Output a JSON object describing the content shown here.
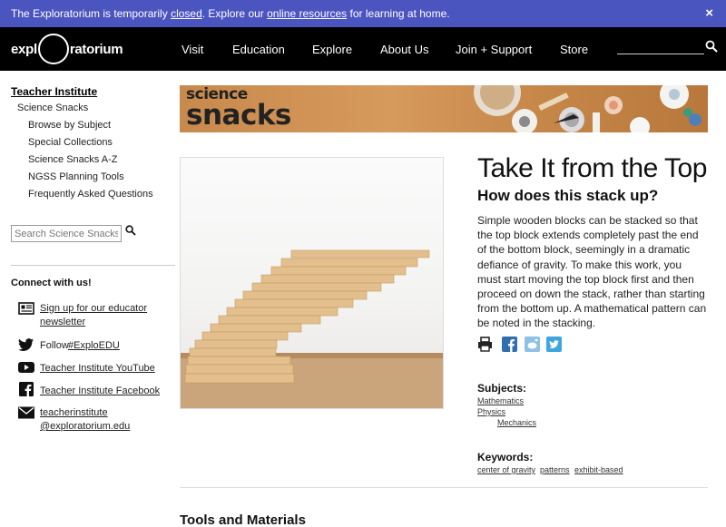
{
  "notice": {
    "prefix": "The Exploratorium is temporarily ",
    "closed_link": "closed",
    "middle": ". Explore our ",
    "resources_link": "online resources",
    "suffix": " for learning at home.",
    "close_symbol": "×"
  },
  "header": {
    "logo_left": "expl",
    "logo_right": "ratorium",
    "nav": [
      "Visit",
      "Education",
      "Explore",
      "About Us",
      "Join + Support",
      "Store"
    ],
    "search_icon": "search-icon"
  },
  "sidebar": {
    "title": "Teacher Institute",
    "links": [
      "Science Snacks",
      "Browse by Subject",
      "Special Collections",
      "Science Snacks A-Z",
      "NGSS Planning Tools",
      "Frequently Asked Questions"
    ],
    "search_placeholder": "Search Science Snacks",
    "connect_title": "Connect with us!",
    "social": [
      {
        "icon": "newsletter-icon",
        "line1": "Sign up for our educator",
        "line2": "newsletter"
      },
      {
        "icon": "twitter-icon",
        "prefix": "Follow ",
        "link": "#ExploEDU"
      },
      {
        "icon": "youtube-icon",
        "line1": "Teacher Institute YouTube"
      },
      {
        "icon": "facebook-icon",
        "line1": "Teacher Institute Facebook"
      },
      {
        "icon": "email-icon",
        "line1": "teacherinstitute",
        "line2": "@exploratorium.edu"
      }
    ]
  },
  "banner": {
    "line1": "science",
    "line2": "snacks"
  },
  "article": {
    "title": "Take It from the Top",
    "subtitle": "How does this stack up?",
    "description": "Simple wooden blocks can be stacked so that the top block extends completely past the end of the bottom block, seemingly in a dramatic defiance of gravity. To make this work, you must start moving the top block first and then proceed on down the stack, rather than starting from the bottom up. A mathematical pattern can be noted in the stacking.",
    "share_icons": [
      "print-icon",
      "facebook-share-icon",
      "reddit-share-icon",
      "twitter-share-icon"
    ],
    "subjects_label": "Subjects:",
    "subjects": [
      "Mathematics",
      "Physics",
      "Mechanics"
    ],
    "keywords_label": "Keywords:",
    "keywords": [
      "center of gravity",
      "patterns",
      "exhibit-based"
    ],
    "section_title": "Tools and Materials"
  },
  "colors": {
    "notice_bg": "#4b55bf",
    "nav_bg": "#000000",
    "share_blue": "#2f7fbf"
  }
}
